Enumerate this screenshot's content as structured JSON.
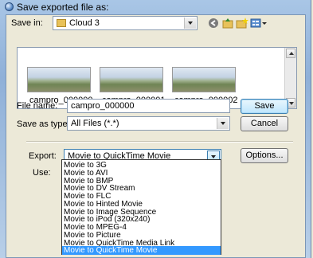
{
  "window": {
    "title": "Save exported file as:"
  },
  "save_in": {
    "label": "Save in:",
    "value": "Cloud 3"
  },
  "files": [
    {
      "name": "campro_000000"
    },
    {
      "name": "campro_000001"
    },
    {
      "name": "campro_000002"
    }
  ],
  "file_name": {
    "label": "File name:",
    "value": "campro_000000"
  },
  "save_as_type": {
    "label": "Save as type:",
    "value": "All Files (*.*)"
  },
  "buttons": {
    "save": "Save",
    "cancel": "Cancel",
    "options": "Options..."
  },
  "export": {
    "label": "Export:",
    "value": "Movie to QuickTime Movie",
    "options": [
      "Movie to 3G",
      "Movie to AVI",
      "Movie to BMP",
      "Movie to DV Stream",
      "Movie to FLC",
      "Movie to Hinted Movie",
      "Movie to Image Sequence",
      "Movie to iPod (320x240)",
      "Movie to MPEG-4",
      "Movie to Picture",
      "Movie to QuickTime Media Link",
      "Movie to QuickTime Movie"
    ],
    "selected_index": 11
  },
  "use": {
    "label": "Use:"
  },
  "icons": {
    "title": "quicktime-icon",
    "folder": "folder-icon",
    "back": "back-icon",
    "up": "up-folder-icon",
    "new_folder": "new-folder-icon",
    "views": "views-icon"
  },
  "colors": {
    "selection": "#3399ff",
    "title_gradient": "#a9c6e6"
  }
}
